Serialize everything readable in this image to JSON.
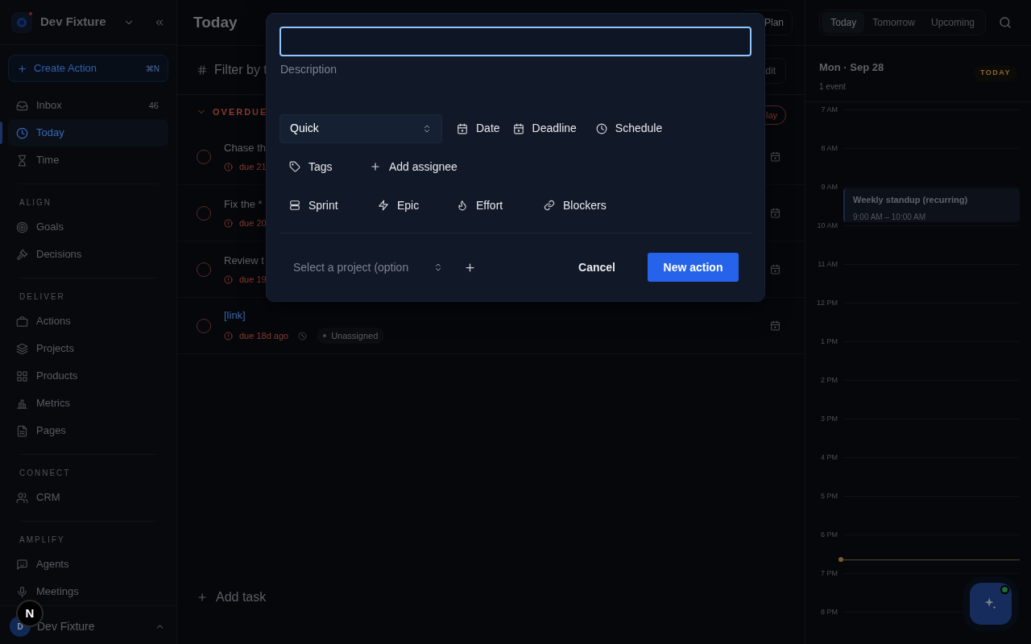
{
  "sidebar": {
    "workspace": "Dev Fixture",
    "create": {
      "label": "Create Action",
      "shortcut": "⌘N"
    },
    "items": [
      {
        "label": "Inbox",
        "count": "46",
        "selected": false
      },
      {
        "label": "Today",
        "selected": true
      },
      {
        "label": "Time",
        "selected": false
      }
    ],
    "sections": [
      {
        "title": "ALIGN",
        "items": [
          {
            "label": "Goals",
            "selected": false
          },
          {
            "label": "Decisions",
            "selected": false
          }
        ]
      },
      {
        "title": "DELIVER",
        "items": [
          {
            "label": "Actions",
            "selected": false
          },
          {
            "label": "Projects",
            "selected": false
          },
          {
            "label": "Products",
            "selected": false
          },
          {
            "label": "Metrics",
            "selected": false
          },
          {
            "label": "Pages",
            "selected": false
          }
        ]
      },
      {
        "title": "CONNECT",
        "items": [
          {
            "label": "CRM",
            "selected": false
          }
        ]
      },
      {
        "title": "AMPLIFY",
        "items": [
          {
            "label": "Agents",
            "selected": false
          },
          {
            "label": "Meetings",
            "selected": false
          }
        ]
      }
    ],
    "user": {
      "initials": "D",
      "name": "Dev Fixture"
    }
  },
  "dev_badge": "N",
  "main": {
    "title": "Today",
    "plan_button": "Plan",
    "views": [
      {
        "label": "Today",
        "selected": true
      },
      {
        "label": "Tomorrow",
        "selected": false
      },
      {
        "label": "Upcoming",
        "selected": false
      }
    ],
    "filter": {
      "placeholder": "Filter by t"
    },
    "edit_button": "dit",
    "section": {
      "title": "OVERDUE",
      "expanded": true,
      "pill": "lay"
    },
    "tasks": [
      {
        "kind": "text",
        "title": "Chase th",
        "due": "due 21",
        "checked": false
      },
      {
        "kind": "text",
        "title": "Fix the *",
        "due": "due 20",
        "checked": false
      },
      {
        "kind": "text",
        "title": "Review t",
        "due": "due 19",
        "checked": false
      },
      {
        "kind": "link",
        "title": "[link]",
        "due": "due 18d ago",
        "assignee": "Unassigned",
        "checked": false
      }
    ],
    "add_task": "Add task"
  },
  "calendar": {
    "day": "Mon · Sep 28",
    "event_count": "1 event",
    "badge": "TODAY",
    "hours": [
      {
        "label": "7 AM",
        "now": false
      },
      {
        "label": "8 AM",
        "now": false
      },
      {
        "label": "9 AM",
        "now": false,
        "events": [
          {
            "title": "Weekly standup (recurring)",
            "time": "9:00 AM – 10:00 AM"
          }
        ]
      },
      {
        "label": "10 AM",
        "now": false
      },
      {
        "label": "11 AM",
        "now": false
      },
      {
        "label": "12 PM",
        "now": false
      },
      {
        "label": "1 PM",
        "now": false
      },
      {
        "label": "2 PM",
        "now": false
      },
      {
        "label": "3 PM",
        "now": false
      },
      {
        "label": "4 PM",
        "now": false
      },
      {
        "label": "5 PM",
        "now": false
      },
      {
        "label": "6 PM",
        "now": true
      },
      {
        "label": "7 PM",
        "now": false
      },
      {
        "label": "8 PM",
        "now": false
      }
    ]
  },
  "modal": {
    "title_field": {
      "focused": true
    },
    "description": {
      "placeholder": "Description"
    },
    "type_select": {
      "value": "Quick"
    },
    "option_rows": [
      {
        "options": [
          {
            "label": "Date"
          },
          {
            "label": "Deadline"
          },
          {
            "label": "Schedule"
          }
        ]
      },
      {
        "options": [
          {
            "label": "Tags"
          },
          {
            "label": "Add assignee"
          }
        ]
      },
      {
        "options": [
          {
            "label": "Sprint"
          },
          {
            "label": "Epic"
          },
          {
            "label": "Effort"
          },
          {
            "label": "Blockers"
          }
        ]
      }
    ],
    "project_select": {
      "placeholder": "Select a project (option"
    },
    "cancel": "Cancel",
    "submit": "New action"
  }
}
